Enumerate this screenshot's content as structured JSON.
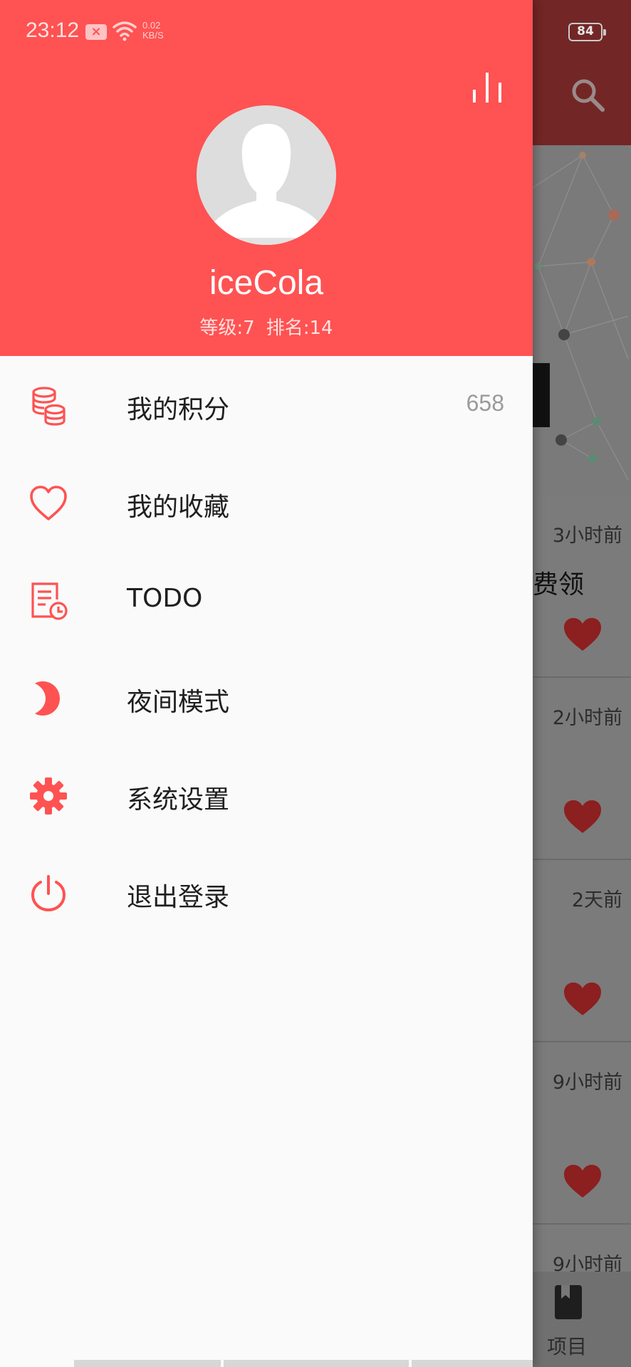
{
  "status_bar": {
    "time": "23:12",
    "speed_value": "0.02",
    "speed_unit": "KB/S",
    "battery": "84",
    "icons": [
      "notification-x-icon",
      "wifi-icon",
      "battery-icon"
    ]
  },
  "background": {
    "toolbar_icon": "search-icon",
    "list": [
      {
        "time": "3小时前",
        "title": "费领"
      },
      {
        "time": "2小时前",
        "title": ""
      },
      {
        "time": "2天前",
        "title": ""
      },
      {
        "time": "9小时前",
        "title": ""
      },
      {
        "time": "9小时前",
        "title": ""
      }
    ],
    "bottom_nav": {
      "label": "项目",
      "icon": "book-icon"
    }
  },
  "drawer": {
    "header": {
      "rank_icon": "bar-chart-icon",
      "avatar_icon": "person-silhouette-icon",
      "username": "iceCola",
      "level": "等级:7",
      "rank": "排名:14"
    },
    "menu": [
      {
        "label": "我的积分",
        "value": "658",
        "icon": "coins-icon"
      },
      {
        "label": "我的收藏",
        "value": "",
        "icon": "heart-outline-icon"
      },
      {
        "label": "TODO",
        "value": "",
        "icon": "todo-clock-icon"
      },
      {
        "label": "夜间模式",
        "value": "",
        "icon": "moon-icon"
      },
      {
        "label": "系统设置",
        "value": "",
        "icon": "gear-icon"
      },
      {
        "label": "退出登录",
        "value": "",
        "icon": "power-icon"
      }
    ]
  },
  "colors": {
    "accent": "#ff5252",
    "drawer_bg": "#fafafa",
    "text": "#1f1f1f",
    "secondary_text": "#9a9a9a"
  }
}
